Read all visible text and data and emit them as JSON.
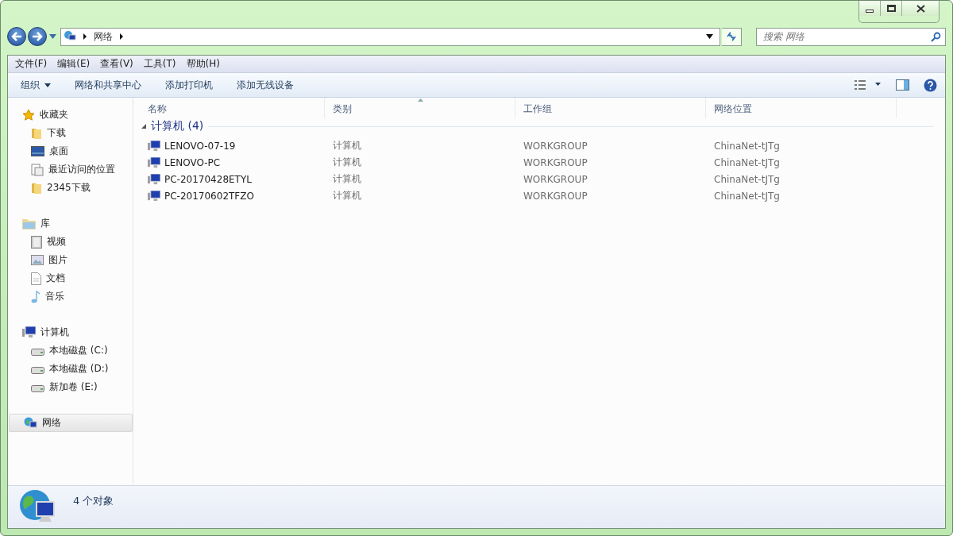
{
  "address_bar": {
    "path": [
      "网络"
    ]
  },
  "search": {
    "placeholder": "搜索 网络"
  },
  "menu_bar": [
    "文件(F)",
    "编辑(E)",
    "查看(V)",
    "工具(T)",
    "帮助(H)"
  ],
  "toolbar": {
    "organize": "组织",
    "buttons": [
      "网络和共享中心",
      "添加打印机",
      "添加无线设备"
    ]
  },
  "sidebar": {
    "sections": [
      {
        "label": "收藏夹",
        "selected": false,
        "children": [
          {
            "label": "下载",
            "selected": false
          },
          {
            "label": "桌面",
            "selected": false
          },
          {
            "label": "最近访问的位置",
            "selected": false
          },
          {
            "label": "2345下载",
            "selected": false
          }
        ]
      },
      {
        "label": "库",
        "selected": false,
        "children": [
          {
            "label": "视频",
            "selected": false
          },
          {
            "label": "图片",
            "selected": false
          },
          {
            "label": "文档",
            "selected": false
          },
          {
            "label": "音乐",
            "selected": false
          }
        ]
      },
      {
        "label": "计算机",
        "selected": false,
        "children": [
          {
            "label": "本地磁盘 (C:)",
            "selected": false
          },
          {
            "label": "本地磁盘 (D:)",
            "selected": false
          },
          {
            "label": "新加卷 (E:)",
            "selected": false
          }
        ]
      },
      {
        "label": "网络",
        "selected": true
      }
    ]
  },
  "table": {
    "columns": [
      {
        "label": "名称",
        "sorted": false
      },
      {
        "label": "类别",
        "sorted": true
      },
      {
        "label": "工作组",
        "sorted": false
      },
      {
        "label": "网络位置",
        "sorted": false
      }
    ],
    "group": {
      "label": "计算机 (4)",
      "expanded": true
    },
    "rows": [
      {
        "name": "LENOVO-07-19",
        "category": "计算机",
        "workgroup": "WORKGROUP",
        "location": "ChinaNet-tJTg"
      },
      {
        "name": "LENOVO-PC",
        "category": "计算机",
        "workgroup": "WORKGROUP",
        "location": "ChinaNet-tJTg"
      },
      {
        "name": "PC-20170428ETYL",
        "category": "计算机",
        "workgroup": "WORKGROUP",
        "location": "ChinaNet-tJTg"
      },
      {
        "name": "PC-20170602TFZO",
        "category": "计算机",
        "workgroup": "WORKGROUP",
        "location": "ChinaNet-tJTg"
      }
    ]
  },
  "status_bar": {
    "text": "4 个对象"
  }
}
